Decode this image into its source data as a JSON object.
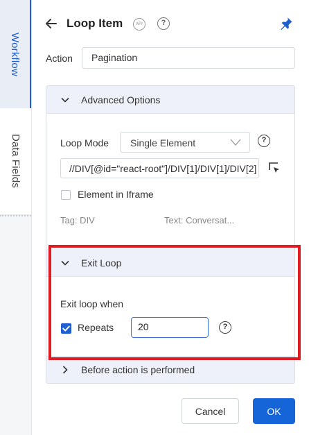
{
  "side_tabs": [
    {
      "label": "Workflow",
      "active": true
    },
    {
      "label": "Data Fields",
      "active": false
    }
  ],
  "header": {
    "title": "Loop Item",
    "api_badge": "API",
    "help_glyph": "?",
    "icons": [
      "arrow-left-icon",
      "api-icon",
      "help-icon",
      "pin-icon"
    ]
  },
  "action": {
    "label": "Action",
    "value": "Pagination"
  },
  "advanced": {
    "header_label": "Advanced Options",
    "loop_mode_label": "Loop Mode",
    "loop_mode_value": "Single Element",
    "xpath_value": "//DIV[@id=\"react-root\"]/DIV[1]/DIV[1]/DIV[2]",
    "iframe_label": "Element in Iframe",
    "iframe_checked": false,
    "tag_text": "Tag: DIV",
    "text_preview": "Text: Conversat..."
  },
  "exit_loop": {
    "header_label": "Exit Loop",
    "when_label": "Exit loop when",
    "repeats_label": "Repeats",
    "repeats_checked": true,
    "repeats_value": "20"
  },
  "before_action": {
    "header_label": "Before action is performed"
  },
  "footer": {
    "cancel_label": "Cancel",
    "ok_label": "OK"
  },
  "colors": {
    "accent": "#1565d8",
    "highlight_frame": "#e11b22",
    "section_header_bg": "#eef1f9"
  }
}
